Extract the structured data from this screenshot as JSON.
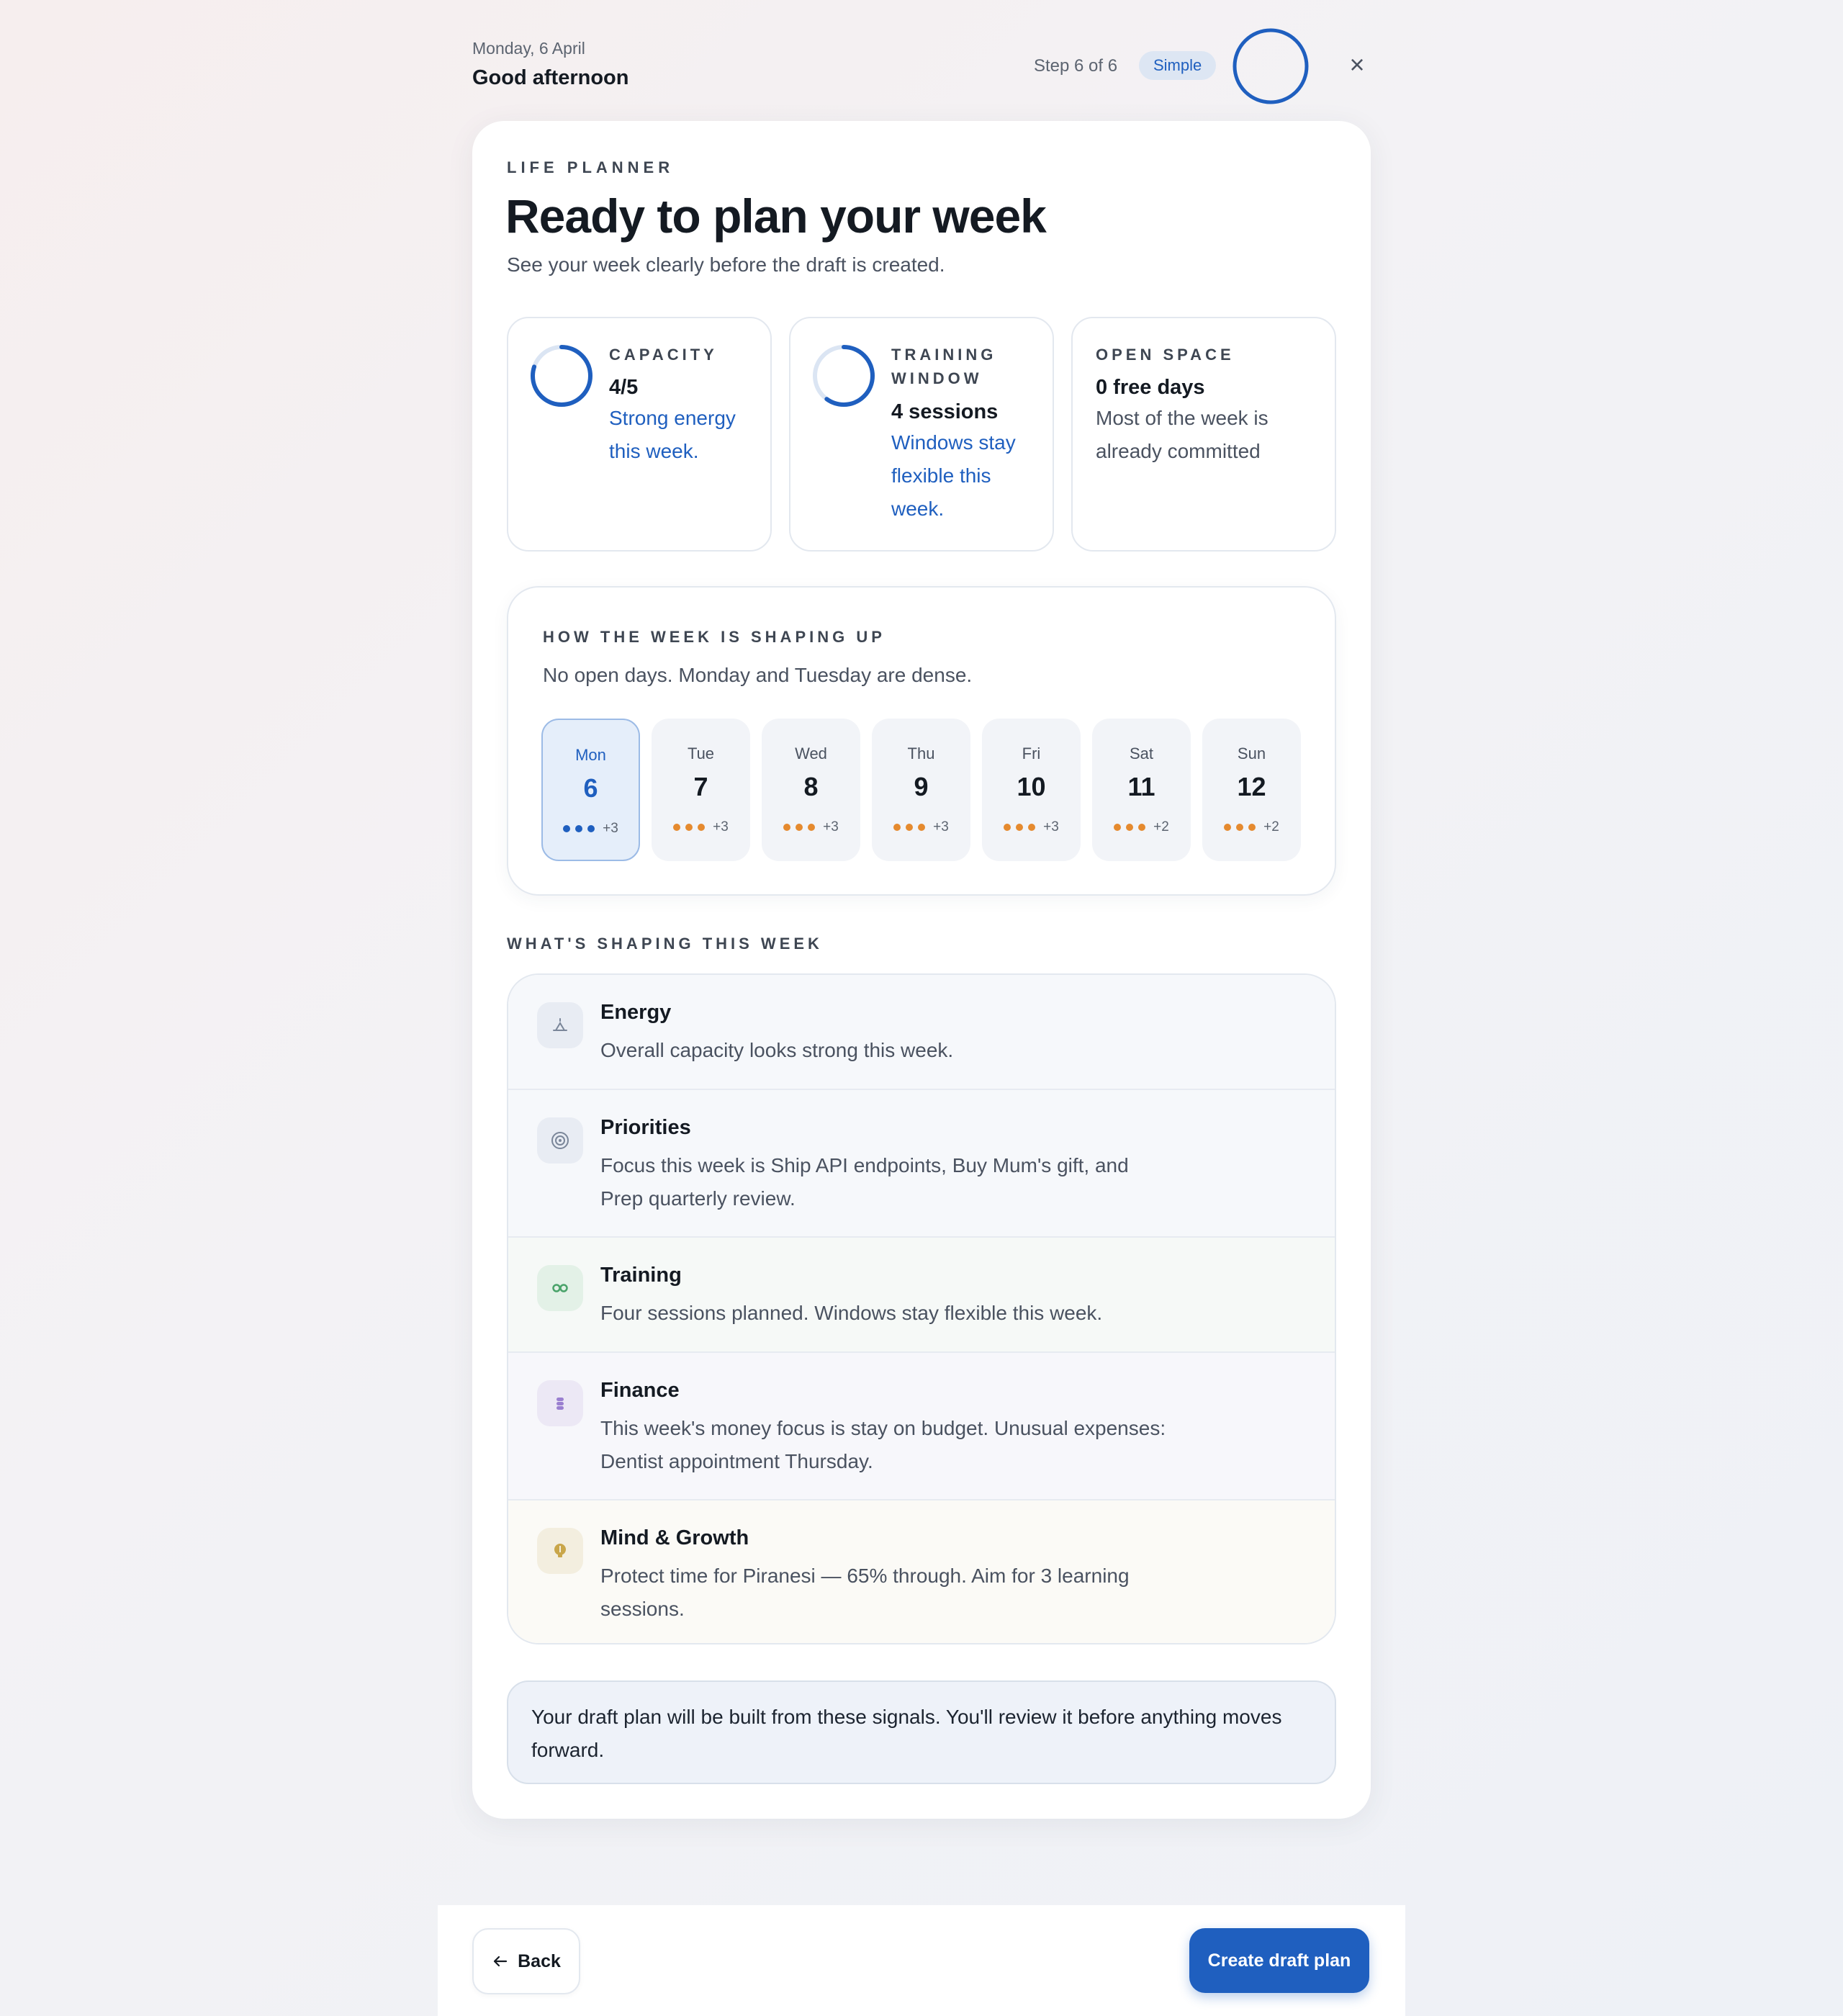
{
  "header": {
    "date": "Monday, 6 April",
    "greeting": "Good afternoon",
    "step": "Step 6 of 6",
    "mode": "Simple",
    "close_glyph": "×"
  },
  "hero": {
    "eyebrow": "LIFE PLANNER",
    "title": "Ready to plan your week",
    "subtitle": "See your week clearly before the draft is created."
  },
  "stats": {
    "capacity": {
      "label": "CAPACITY",
      "value": "4/5",
      "note": "Strong energy this week.",
      "progress": 0.8
    },
    "training": {
      "label": "TRAINING WINDOW",
      "value": "4 sessions",
      "note": "Windows stay flexible this week.",
      "progress": 0.6
    },
    "open_space": {
      "label": "OPEN SPACE",
      "value": "0 free days",
      "note": "Most of the week is already committed"
    }
  },
  "week": {
    "heading": "HOW THE WEEK IS SHAPING UP",
    "summary": "No open days. Monday and Tuesday are dense.",
    "days": [
      {
        "name": "Mon",
        "num": "6",
        "more": "+3"
      },
      {
        "name": "Tue",
        "num": "7",
        "more": "+3"
      },
      {
        "name": "Wed",
        "num": "8",
        "more": "+3"
      },
      {
        "name": "Thu",
        "num": "9",
        "more": "+3"
      },
      {
        "name": "Fri",
        "num": "10",
        "more": "+3"
      },
      {
        "name": "Sat",
        "num": "11",
        "more": "+2"
      },
      {
        "name": "Sun",
        "num": "12",
        "more": "+2"
      }
    ]
  },
  "shaping": {
    "heading": "WHAT'S SHAPING THIS WEEK",
    "factors": {
      "energy": {
        "title": "Energy",
        "text": "Overall capacity looks strong this week.",
        "icon": "energy-icon"
      },
      "priorities": {
        "title": "Priorities",
        "text": "Focus this week is Ship API endpoints, Buy Mum's gift, and Prep quarterly review.",
        "icon": "target-icon"
      },
      "training": {
        "title": "Training",
        "text": "Four sessions planned. Windows stay flexible this week.",
        "icon": "dumbbell-icon"
      },
      "finance": {
        "title": "Finance",
        "text": "This week's money focus is stay on budget. Unusual expenses: Dentist appointment Thursday.",
        "icon": "coins-icon"
      },
      "mind": {
        "title": "Mind & Growth",
        "text": "Protect time for Piranesi — 65% through. Aim for 3 learning sessions.",
        "icon": "lightbulb-icon"
      }
    }
  },
  "note": "Your draft plan will be built from these signals. You'll review it before anything moves forward.",
  "footer": {
    "back_label": "Back",
    "create_label": "Create draft plan"
  },
  "colors": {
    "accent": "#1f5fbf",
    "dense_dot": "#e58a2f"
  }
}
